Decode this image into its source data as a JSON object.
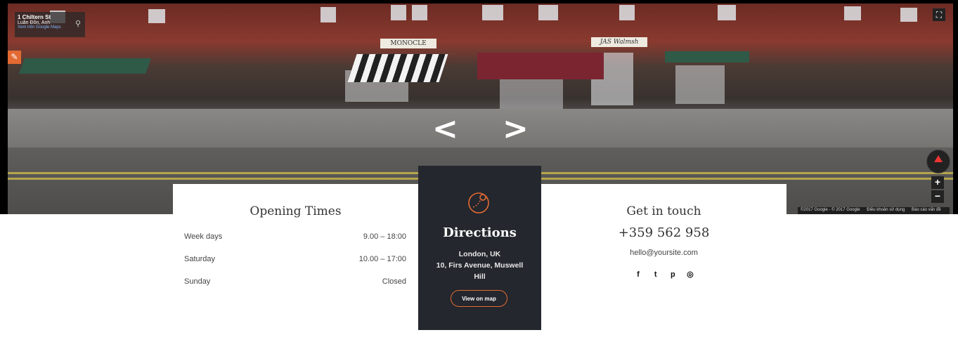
{
  "streetview": {
    "address_title": "1 Chiltern St",
    "address_sub": "Luân Đôn, Anh",
    "address_link": "Xem trên Google Maps",
    "signs": [
      "MONOCLE",
      "JAS Walmsh"
    ],
    "footer": {
      "copyright": "©2017 Google - © 2017 Google",
      "terms": "Điều khoản sử dụng",
      "report": "Báo cáo vấn đề"
    },
    "icons": {
      "pin": "map-pin-icon",
      "brush": "brush-icon",
      "fullscreen": "fullscreen-icon",
      "compass": "compass-icon",
      "prev": "chevron-left-icon",
      "next": "chevron-right-icon"
    },
    "zoom_in": "+",
    "zoom_out": "−",
    "prev_arrow": "<",
    "next_arrow": ">",
    "fullscreen_glyph": "⛶",
    "brush_glyph": "✎",
    "pin_glyph": "⚲"
  },
  "opening_times": {
    "title": "Opening Times",
    "rows": [
      {
        "day": "Week days",
        "hours": "9.00 – 18:00"
      },
      {
        "day": "Saturday",
        "hours": "10.00 – 17:00"
      },
      {
        "day": "Sunday",
        "hours": "Closed"
      }
    ]
  },
  "directions": {
    "title": "Directions",
    "line1": "London, UK",
    "line2": "10, Firs Avenue, Muswell",
    "line3": "Hill",
    "button": "View on map",
    "accent": "#e36a33",
    "background": "#24272d"
  },
  "get_in_touch": {
    "title": "Get in touch",
    "phone": "+359 562 958",
    "email": "hello@yoursite.com",
    "socials": [
      {
        "name": "facebook-icon",
        "glyph": "f"
      },
      {
        "name": "twitter-icon",
        "glyph": "t"
      },
      {
        "name": "pinterest-icon",
        "glyph": "p"
      },
      {
        "name": "instagram-icon",
        "glyph": "◎"
      }
    ]
  }
}
